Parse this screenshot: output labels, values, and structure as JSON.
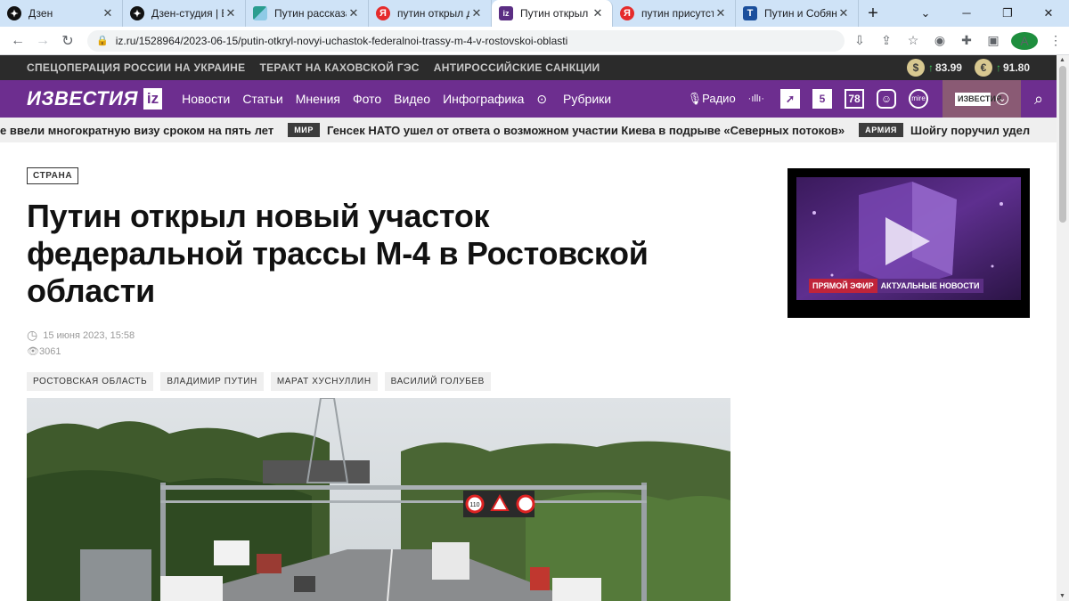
{
  "browser": {
    "tabs": [
      {
        "label": "Дзен",
        "color": "#000000",
        "icon": "dzen-icon"
      },
      {
        "label": "Дзен-студия | Ве",
        "color": "#000000",
        "icon": "dzen-icon"
      },
      {
        "label": "Путин рассказал",
        "color": "#2a9d8f",
        "icon": "site-icon"
      },
      {
        "label": "путин открыл до",
        "color": "#e52b2b",
        "icon": "yandex-icon"
      },
      {
        "label": "Путин открыл но",
        "color": "#5b2e83",
        "icon": "iz-icon"
      },
      {
        "label": "путин присутств",
        "color": "#e52b2b",
        "icon": "yandex-icon"
      },
      {
        "label": "Путин и Собянин",
        "color": "#1b4f9c",
        "icon": "t-icon"
      }
    ],
    "tab_glyphs": [
      "✦",
      "✦",
      "",
      "Я",
      "iz",
      "Я",
      "T"
    ],
    "url": "iz.ru/1528964/2023-06-15/putin-otkryl-novyi-uchastok-federalnoi-trassy-m-4-v-rostovskoi-oblasti",
    "avatar": "A"
  },
  "topstrip": {
    "links": [
      "СПЕЦОПЕРАЦИЯ РОССИИ НА УКРАИНЕ",
      "ТЕРАКТ НА КАХОВСКОЙ ГЭС",
      "АНТИРОССИЙСКИЕ САНКЦИИ"
    ],
    "usd_symbol": "$",
    "usd": "83.99",
    "eur_symbol": "€",
    "eur": "91.80"
  },
  "nav": {
    "logo_word": "ИЗВЕСТИЯ",
    "logo_iz": "iz",
    "links": [
      "Новости",
      "Статьи",
      "Мнения",
      "Фото",
      "Видео",
      "Инфографика"
    ],
    "rubrics": "Рубрики",
    "radio": "Радио",
    "icon_78": "78",
    "icon_5": "5",
    "mini_logo": "ИЗВЕСТИЯ"
  },
  "ticker": {
    "item1": "е ввели многократную визу сроком на пять лет",
    "tag1": "МИР",
    "item2": "Генсек НАТО ушел от ответа о возможном участии Киева в подрыве «Северных потоков»",
    "tag2": "АРМИЯ",
    "item3": "Шойгу поручил удел"
  },
  "article": {
    "rubric": "СТРАНА",
    "title": "Путин открыл новый участок федеральной трассы М-4 в Ростовской области",
    "date": "15 июня 2023, 15:58",
    "views": "3061",
    "tags": [
      "РОСТОВСКАЯ ОБЛАСТЬ",
      "ВЛАДИМИР ПУТИН",
      "МАРАТ ХУСНУЛЛИН",
      "ВАСИЛИЙ ГОЛУБЕВ"
    ],
    "sign_speed": "110"
  },
  "tv": {
    "live": "ПРЯМОЙ ЭФИР",
    "news": "АКТУАЛЬНЫЕ НОВОСТИ"
  },
  "colors": {
    "brand_purple": "#6d2e8f",
    "up_green": "#3cc55a"
  }
}
